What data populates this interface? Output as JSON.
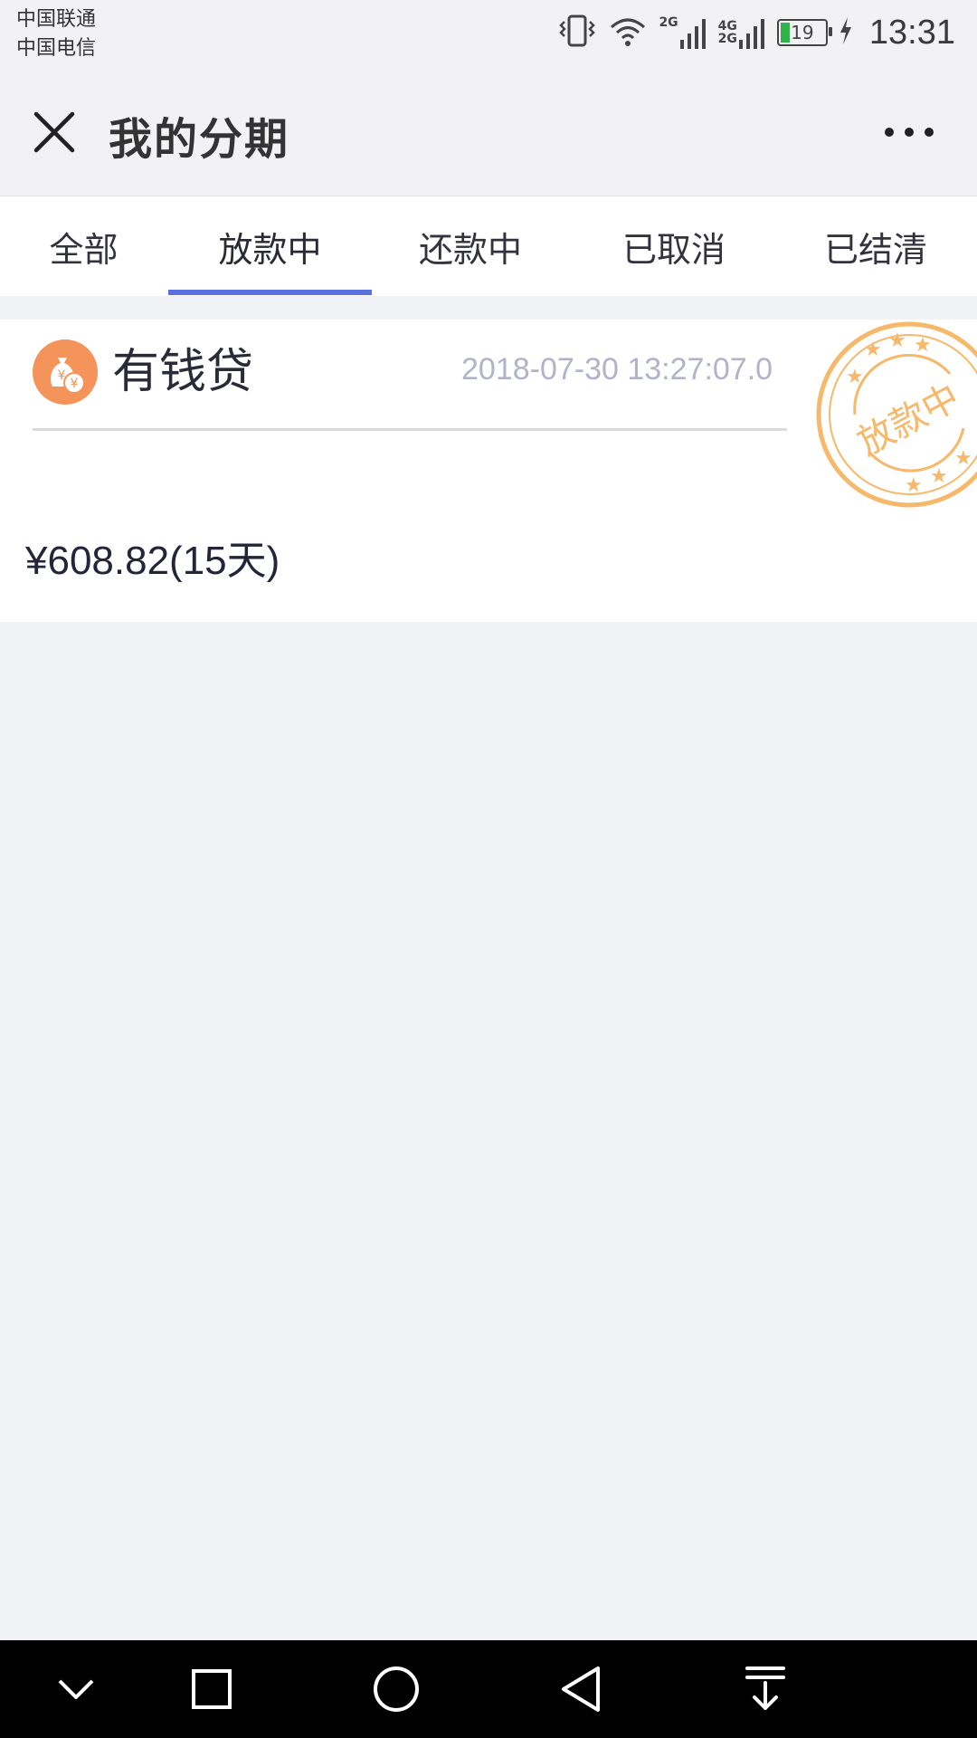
{
  "status_bar": {
    "carrier1": "中国联通",
    "carrier2": "中国电信",
    "net_2g": "2G",
    "net_4g": "4G",
    "net_2g_b": "2G",
    "battery": "19",
    "time": "13:31",
    "battery_color": "#2fb34a"
  },
  "header": {
    "title": "我的分期",
    "close_icon": "close-icon",
    "more_icon": "more-icon"
  },
  "tabs": [
    {
      "label": "全部",
      "selected": false
    },
    {
      "label": "放款中",
      "selected": true
    },
    {
      "label": "还款中",
      "selected": false
    },
    {
      "label": "已取消",
      "selected": false
    },
    {
      "label": "已结清",
      "selected": false
    }
  ],
  "accent_color": "#5b72dd",
  "loan": {
    "product": "有钱贷",
    "datetime": "2018-07-30 13:27:07.0",
    "amount": "¥608.82(15天)",
    "stamp_text": "放款中",
    "stamp_color": "#f6b86a",
    "logo_color": "#f4935a"
  },
  "nav": {
    "icons": [
      "chevron-down-icon",
      "square-icon",
      "circle-icon",
      "back-triangle-icon",
      "download-icon"
    ]
  }
}
